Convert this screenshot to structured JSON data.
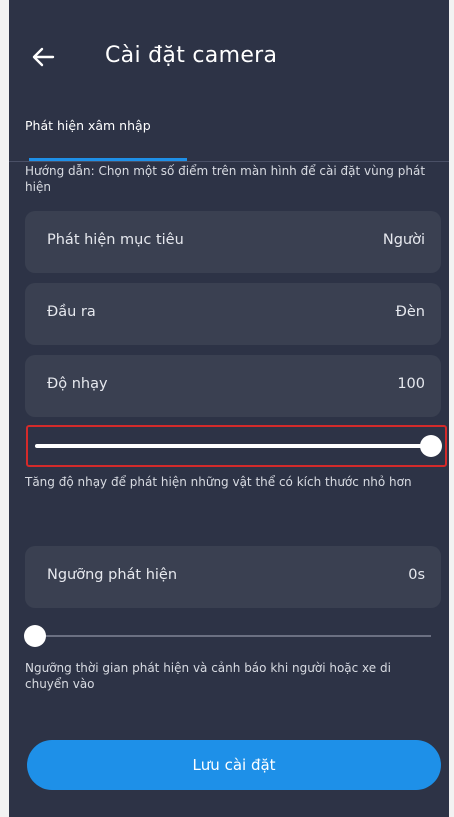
{
  "header": {
    "back_icon": "arrow-left-icon",
    "title": "Cài đặt camera"
  },
  "tab": {
    "label": "Phát hiện xâm nhập",
    "indicator_color": "#1e90e8"
  },
  "guide_text": "Hướng dẫn: Chọn một số điểm trên màn hình để cài đặt vùng phát hiện",
  "settings": {
    "target": {
      "label": "Phát hiện mục tiêu",
      "value": "Người"
    },
    "output": {
      "label": "Đầu ra",
      "value": "Đèn"
    },
    "sensitivity": {
      "label": "Độ nhạy",
      "value": "100"
    },
    "threshold": {
      "label": "Ngưỡng phát hiện",
      "value": "0s"
    }
  },
  "sliders": {
    "sensitivity_fraction": 1.0,
    "threshold_fraction": 0.0
  },
  "hints": {
    "sensitivity": "Tăng độ nhạy để phát hiện những vật thể có kích thước nhỏ hơn",
    "threshold": "Ngưỡng thời gian phát hiện và cảnh báo khi người hoặc xe di chuyển vào"
  },
  "save_label": "Lưu cài đặt",
  "colors": {
    "background": "#2d3346",
    "card": "#3a4051",
    "accent": "#1e90e8",
    "highlight": "#d42a2a"
  }
}
